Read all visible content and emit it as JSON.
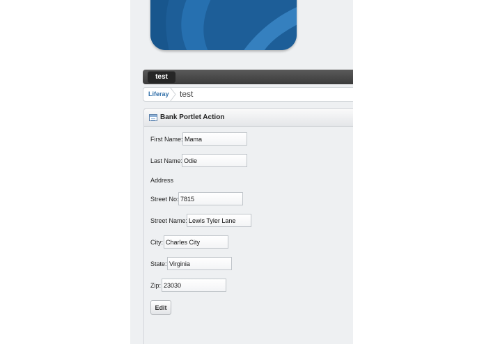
{
  "nav": {
    "tab_label": "test"
  },
  "breadcrumb": {
    "root": "Liferay",
    "current": "test"
  },
  "portlet": {
    "title": "Bank Portlet Action",
    "address_heading": "Address",
    "fields": {
      "first_name": {
        "label": "First Name:",
        "value": "Mama"
      },
      "last_name": {
        "label": "Last Name:",
        "value": "Odie"
      },
      "street_no": {
        "label": "Street No:",
        "value": "7815"
      },
      "street_name": {
        "label": "Street Name:",
        "value": "Lewis Tyler Lane"
      },
      "city": {
        "label": "City:",
        "value": "Charles City"
      },
      "state": {
        "label": "State:",
        "value": "Virginia"
      },
      "zip": {
        "label": "Zip:",
        "value": "23030"
      }
    },
    "edit_label": "Edit"
  },
  "colors": {
    "logo_blue": "#1d5e98",
    "nav_dark": "#3b3b3b",
    "link_blue": "#2f6ea8",
    "page_bg": "#eef0f2"
  }
}
